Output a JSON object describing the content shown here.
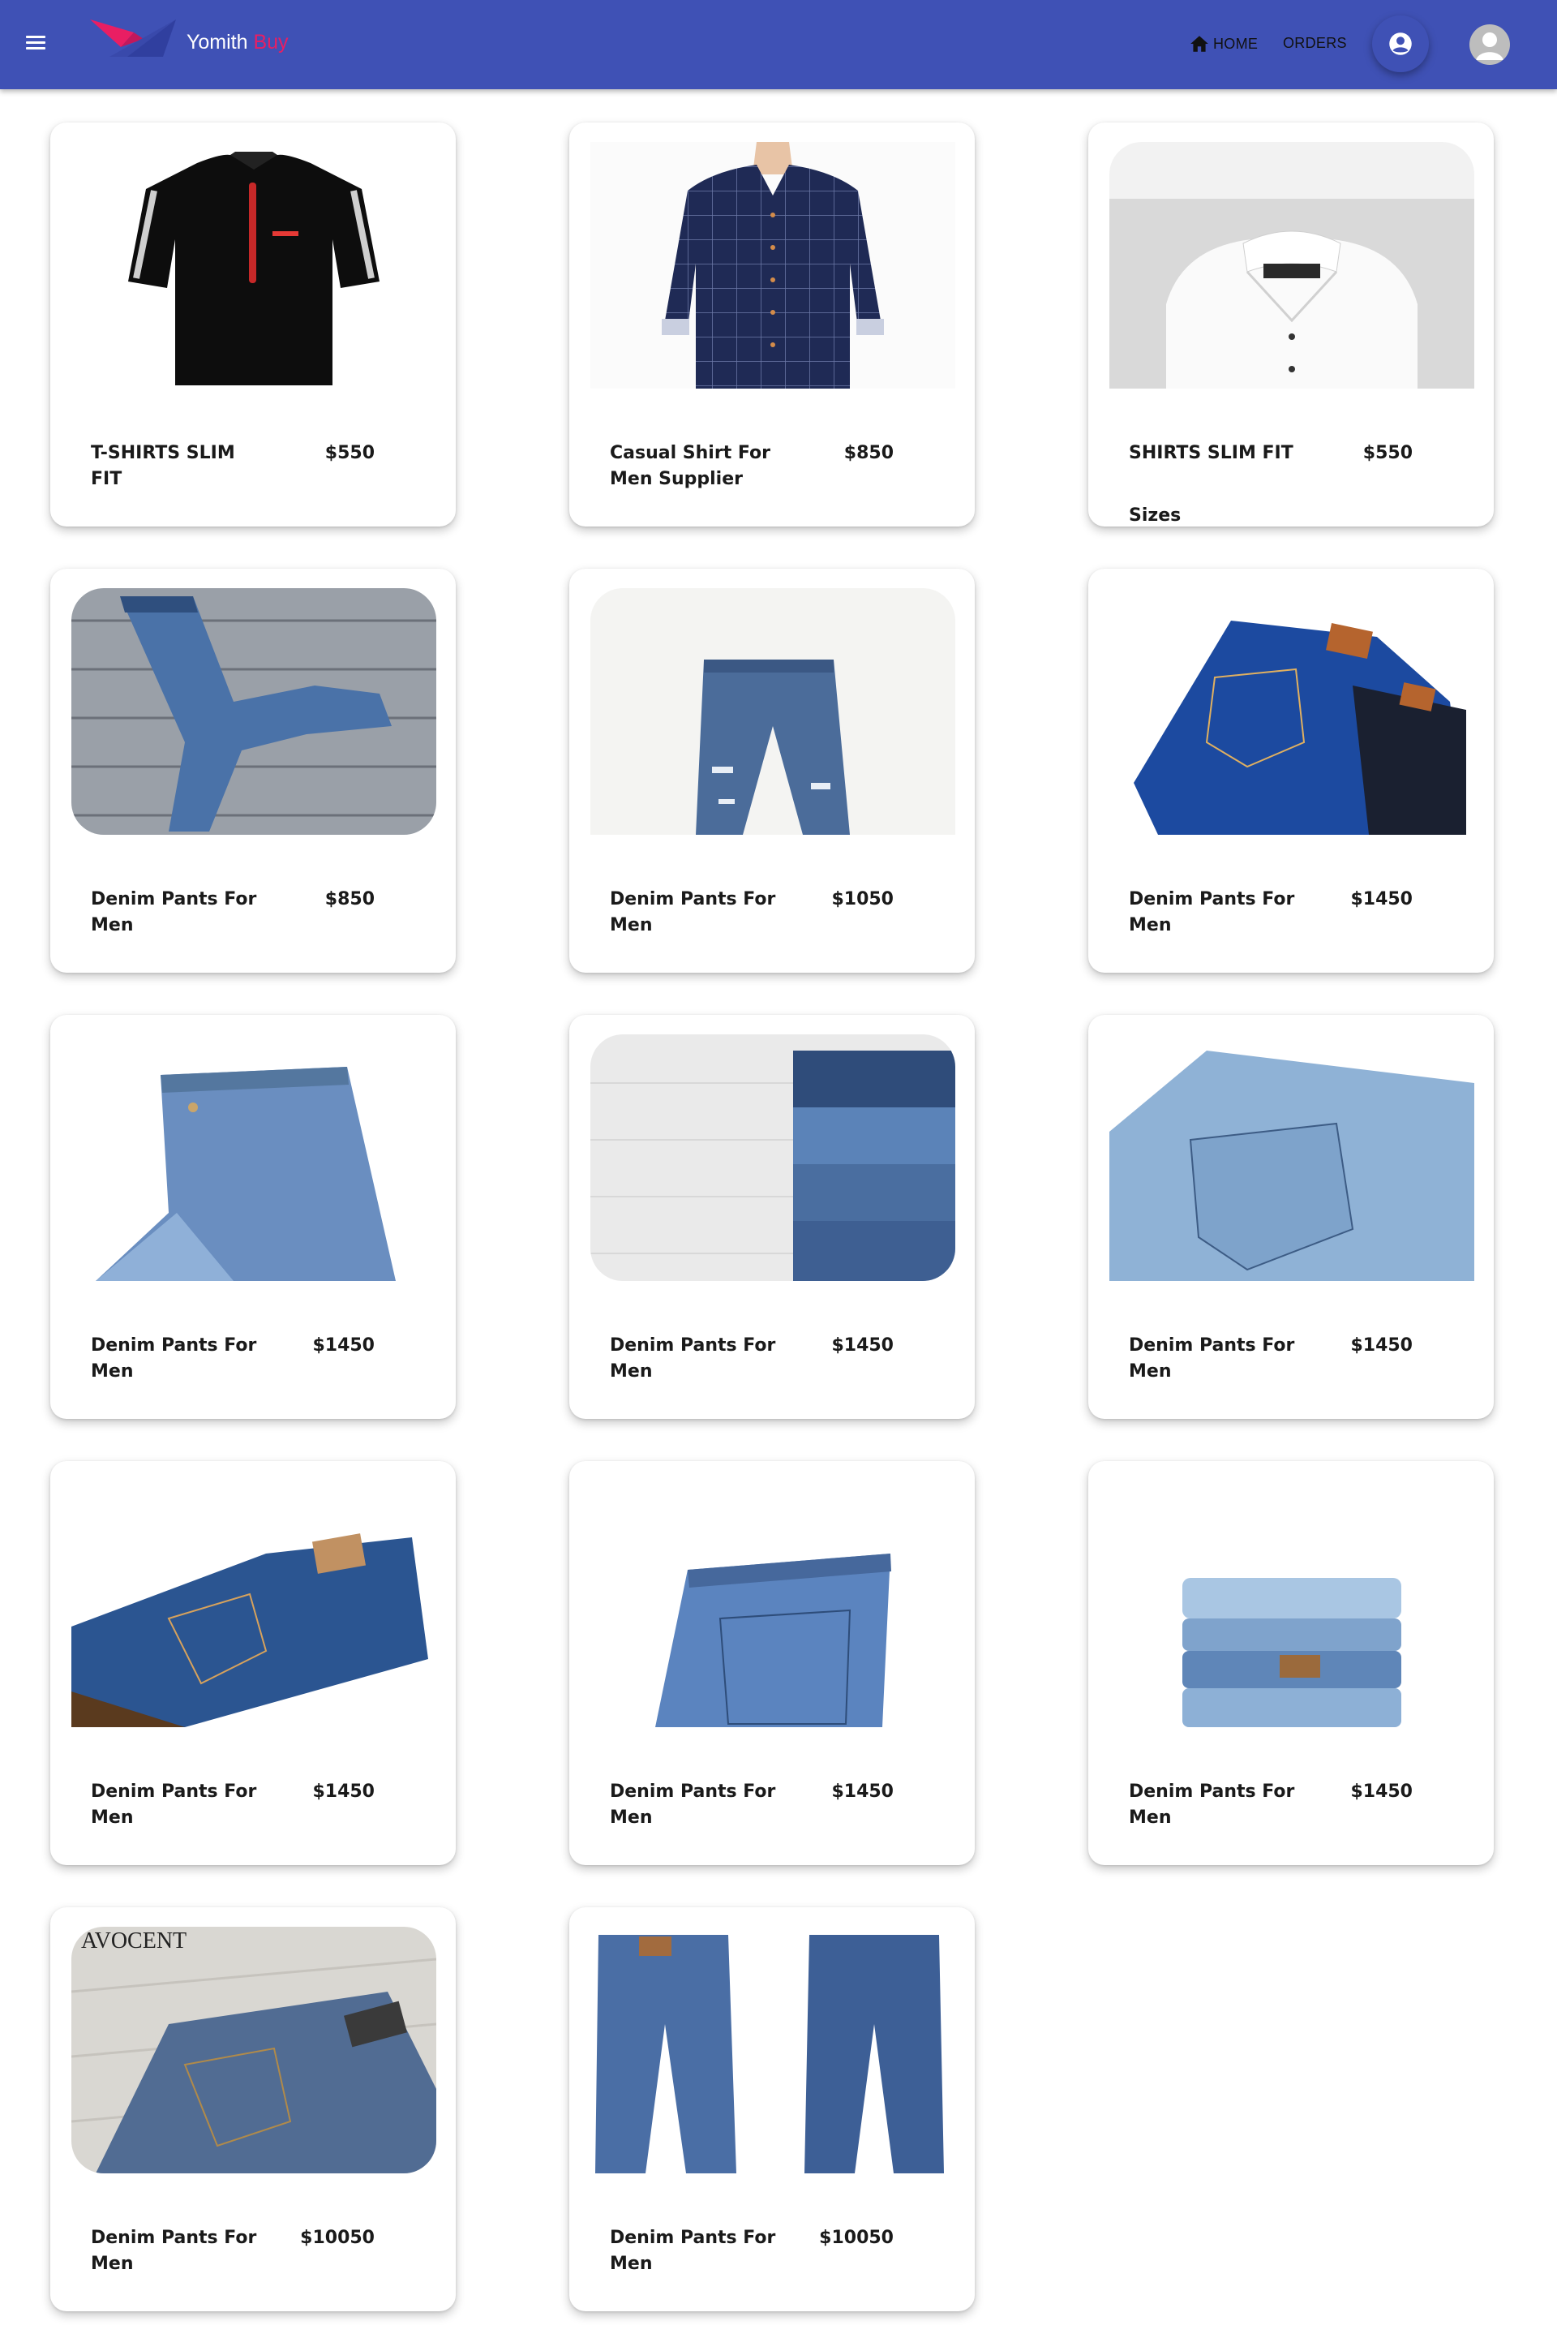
{
  "header": {
    "brand_main": "Yomith",
    "brand_accent": "Buy",
    "nav_home": "HOME",
    "nav_orders": "ORDERS",
    "bar_color": "#3f51b5",
    "accent_color": "#e91e63"
  },
  "products": [
    {
      "name": "T-SHIRTS SLIM FIT",
      "price": "$550",
      "image": "black polo t-shirt"
    },
    {
      "name": "Casual Shirt For Men Supplier",
      "price": "$850",
      "image": "navy checked shirt"
    },
    {
      "name": "SHIRTS SLIM FIT",
      "price": "$550",
      "image": "folded white shirt",
      "extra": "Sizes"
    },
    {
      "name": "Denim Pants For Men",
      "price": "$850",
      "image": "jeans on wooden boards"
    },
    {
      "name": "Denim Pants For Men",
      "price": "$1050",
      "image": "ripped jeans"
    },
    {
      "name": "Denim Pants For Men",
      "price": "$1450",
      "image": "folded blue and black jeans"
    },
    {
      "name": "Denim Pants For Men",
      "price": "$1450",
      "image": "folded light jeans"
    },
    {
      "name": "Denim Pants For Men",
      "price": "$1450",
      "image": "stacked jeans on white wood"
    },
    {
      "name": "Denim Pants For Men",
      "price": "$1450",
      "image": "light jeans close-up"
    },
    {
      "name": "Denim Pants For Men",
      "price": "$1450",
      "image": "folded dark jeans stack"
    },
    {
      "name": "Denim Pants For Men",
      "price": "$1450",
      "image": "jeans back pocket"
    },
    {
      "name": "Denim Pants For Men",
      "price": "$1450",
      "image": "stack of faded jeans"
    },
    {
      "name": "Denim Pants For Men",
      "price": "$10050",
      "image": "jeans with brand watermark",
      "watermark": "AVOCENT"
    },
    {
      "name": "Denim Pants For Men",
      "price": "$10050",
      "image": "jeans front and back"
    }
  ]
}
